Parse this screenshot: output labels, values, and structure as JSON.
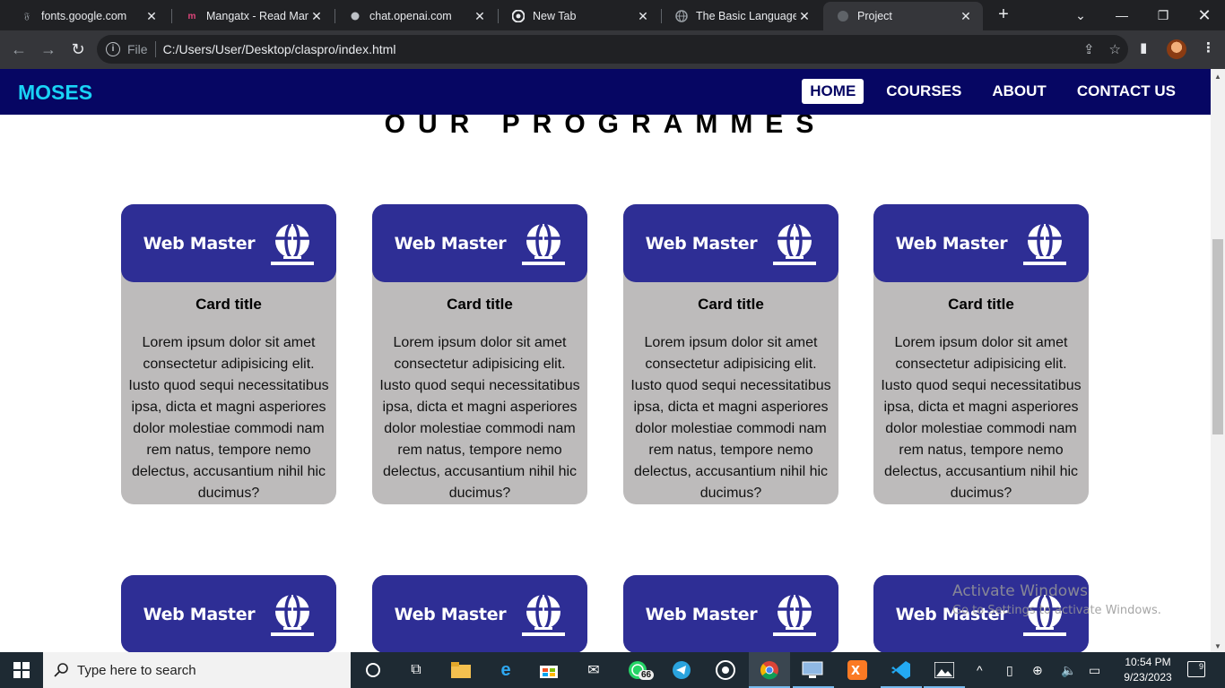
{
  "browser": {
    "tabs": [
      {
        "title": "fonts.google.com",
        "icon": "google-fonts-icon",
        "active": false
      },
      {
        "title": "Mangatx - Read Mang",
        "icon": "mangatx-icon",
        "active": false
      },
      {
        "title": "chat.openai.com",
        "icon": "openai-icon",
        "active": false
      },
      {
        "title": "New Tab",
        "icon": "chrome-icon",
        "active": false
      },
      {
        "title": "The Basic Language of",
        "icon": "globe-icon",
        "active": false
      },
      {
        "title": "Project",
        "icon": "globe-icon",
        "active": true
      }
    ],
    "address": {
      "scheme_label": "File",
      "url": "C:/Users/User/Desktop/claspro/index.html"
    }
  },
  "site": {
    "brand": "MOSES",
    "nav": [
      {
        "label": "HOME",
        "active": true
      },
      {
        "label": "COURSES",
        "active": false
      },
      {
        "label": "ABOUT",
        "active": false
      },
      {
        "label": "CONTACT US",
        "active": false
      }
    ],
    "section_title": "OUR PROGRAMMES",
    "cards": [
      {
        "logo_text": "Web Master",
        "title": "Card title",
        "text": "Lorem ipsum dolor sit amet consectetur adipisicing elit. Iusto quod sequi necessitatibus ipsa, dicta et magni asperiores dolor molestiae commodi nam rem natus, tempore nemo delectus, accusantium nihil hic ducimus?"
      },
      {
        "logo_text": "Web Master",
        "title": "Card title",
        "text": "Lorem ipsum dolor sit amet consectetur adipisicing elit. Iusto quod sequi necessitatibus ipsa, dicta et magni asperiores dolor molestiae commodi nam rem natus, tempore nemo delectus, accusantium nihil hic ducimus?"
      },
      {
        "logo_text": "Web Master",
        "title": "Card title",
        "text": "Lorem ipsum dolor sit amet consectetur adipisicing elit. Iusto quod sequi necessitatibus ipsa, dicta et magni asperiores dolor molestiae commodi nam rem natus, tempore nemo delectus, accusantium nihil hic ducimus?"
      },
      {
        "logo_text": "Web Master",
        "title": "Card title",
        "text": "Lorem ipsum dolor sit amet consectetur adipisicing elit. Iusto quod sequi necessitatibus ipsa, dicta et magni asperiores dolor molestiae commodi nam rem natus, tempore nemo delectus, accusantium nihil hic ducimus?"
      },
      {
        "logo_text": "Web Master"
      },
      {
        "logo_text": "Web Master"
      },
      {
        "logo_text": "Web Master"
      },
      {
        "logo_text": "Web Master"
      }
    ],
    "colors": {
      "nav_bg": "#060663",
      "brand": "#19d3f5",
      "card_head": "#2e2e95",
      "card_body": "#bdbbbb"
    }
  },
  "watermark": {
    "line1": "Activate Windows",
    "line2": "Go to Settings to activate Windows."
  },
  "taskbar": {
    "search_placeholder": "Type here to search",
    "time": "10:54 PM",
    "date": "9/23/2023",
    "whatsapp_badge": "66",
    "notification_count": "9"
  }
}
